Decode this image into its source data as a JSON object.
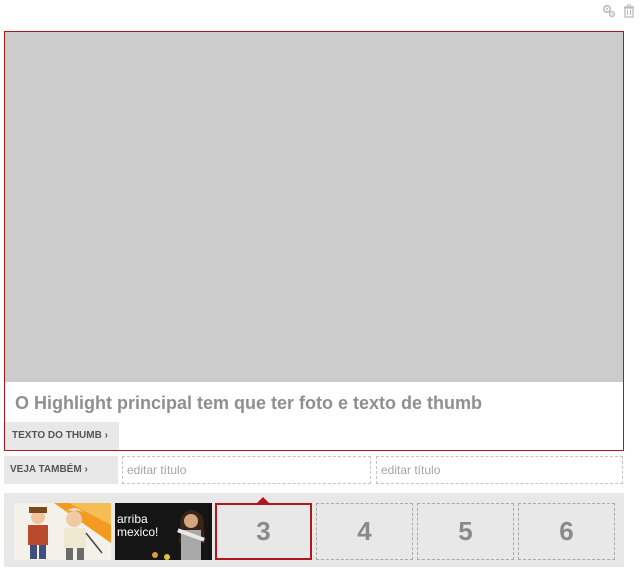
{
  "toolbar": {
    "icons": [
      "settings-icon",
      "trash-icon"
    ]
  },
  "highlight": {
    "title": "O Highlight principal tem que ter foto e texto de thumb",
    "thumb_text_label": "TEXTO DO THUMB ›"
  },
  "veja_tambem": {
    "label": "VEJA TAMBÉM ›",
    "fields": [
      {
        "placeholder": "editar título"
      },
      {
        "placeholder": "editar título"
      }
    ]
  },
  "carousel": {
    "thumbs": [
      {
        "type": "image",
        "icon": "cartoon-characters-thumbnail"
      },
      {
        "type": "image",
        "icon": "miss-universe-thumbnail",
        "caption_line1": "arriba",
        "caption_line2": "mexico!"
      }
    ],
    "slots": [
      "3",
      "4",
      "5",
      "6"
    ],
    "active_slot": "3"
  },
  "colors": {
    "accent": "#b0161c",
    "placeholder_gray": "#cccccc",
    "panel_gray": "#e8e8e8"
  }
}
